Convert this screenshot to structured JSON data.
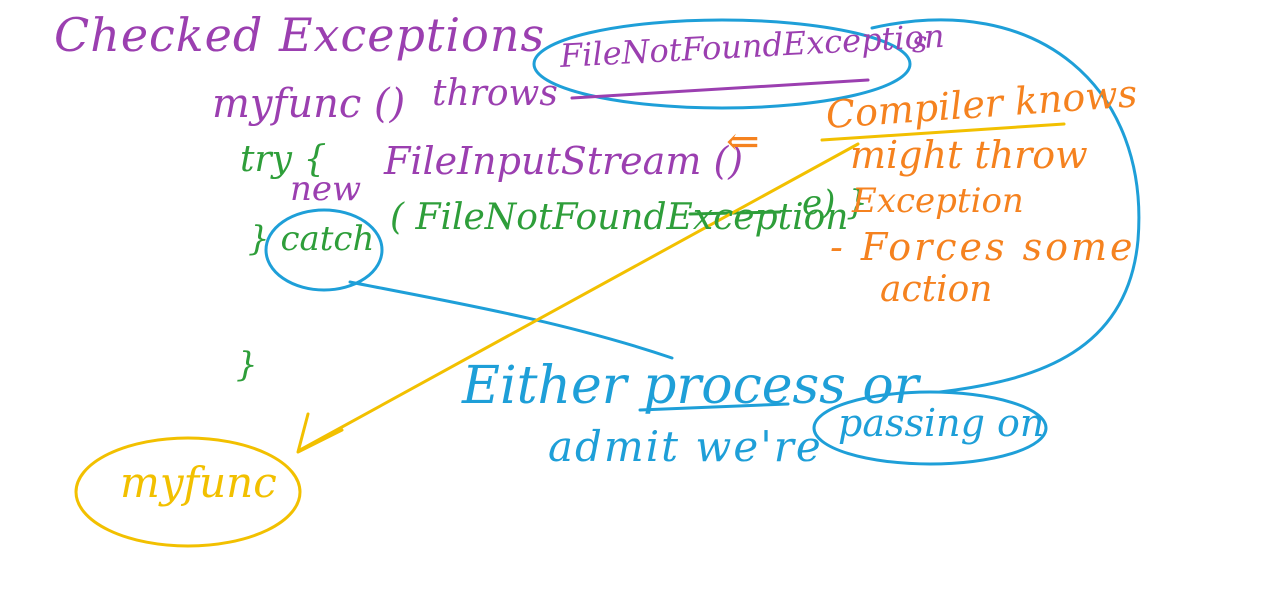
{
  "colors": {
    "background": "#ffffff",
    "purple": "#9b3fb0",
    "green": "#2e9e3a",
    "blue": "#1e9fd8",
    "orange": "#f5821f",
    "yellow": "#f2c000"
  },
  "notes": {
    "title": "Checked Exceptions",
    "fnfe": "FileNotFoundException",
    "semicolon": "s",
    "signature_func": "myfunc ()",
    "signature_throws": "throws",
    "try_kw": "try {",
    "new_kw": "new",
    "fis": "FileInputStream ()",
    "catch_kw": "} catch",
    "catch_ex": "( FileNotFoundException",
    "catch_e": "e) }",
    "close_brace": "}",
    "arrow": "⇐",
    "compiler": "Compiler knows",
    "might": "might throw",
    "exception": "Exception",
    "forces": "- Forces some",
    "action": "action",
    "either": "Either process or",
    "admit": "admit we're",
    "passing": "passing on",
    "myfunc_bottom": "myfunc"
  }
}
